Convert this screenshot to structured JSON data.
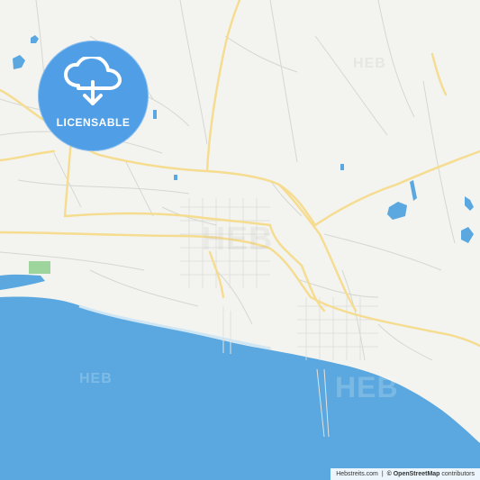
{
  "badge": {
    "label": "LICENSABLE",
    "icon": "cloud-download-icon",
    "color": "#4f9ee6"
  },
  "watermarks": [
    "HEB",
    "HEB",
    "HEB",
    "HEB"
  ],
  "attribution": {
    "site": "Hebstreits.com",
    "separator": "|",
    "copyright": "© OpenStreetMap",
    "suffix": " contributors"
  },
  "colors": {
    "land": "#f3f3ef",
    "water": "#5aa8df",
    "major_road": "#f5dc8f",
    "minor_road": "#d7d7d2",
    "park": "#9ed59c"
  }
}
